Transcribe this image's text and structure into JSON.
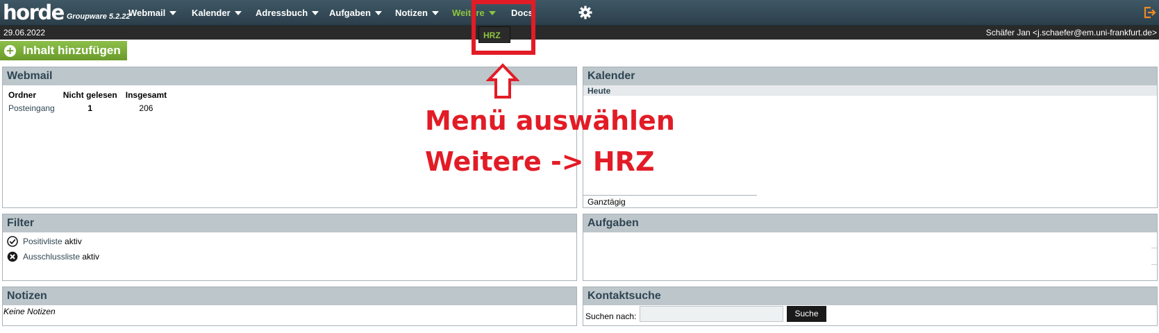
{
  "logo": {
    "word": "horde",
    "subtitle": "Groupware 5.2.22"
  },
  "nav": {
    "items": [
      {
        "label": "Webmail"
      },
      {
        "label": "Kalender"
      },
      {
        "label": "Adressbuch"
      },
      {
        "label": "Aufgaben"
      },
      {
        "label": "Notizen"
      },
      {
        "label": "Weitere"
      },
      {
        "label": "Docs"
      }
    ],
    "active": "Weitere",
    "settings_icon": "gear-icon",
    "logout_icon": "logout-icon"
  },
  "subbar": {
    "date": "29.06.2022",
    "user": "Schäfer Jan <j.schaefer@em.uni-frankfurt.de>"
  },
  "dropdown": {
    "items": [
      "HRZ"
    ]
  },
  "add_content": {
    "label": "Inhalt hinzufügen",
    "icon": "plus-circle-icon"
  },
  "webmail": {
    "title": "Webmail",
    "columns": [
      "Ordner",
      "Nicht gelesen",
      "Insgesamt"
    ],
    "rows": [
      {
        "folder": "Posteingang",
        "unread": "1",
        "total": "206"
      }
    ]
  },
  "kalender": {
    "title": "Kalender",
    "today": "Heute",
    "all_day": "Ganztägig"
  },
  "filter": {
    "title": "Filter",
    "items": [
      {
        "link": "Positivliste",
        "status": "aktiv",
        "icon": "check-circle-icon"
      },
      {
        "link": "Ausschlussliste",
        "status": "aktiv",
        "icon": "x-circle-icon"
      }
    ]
  },
  "aufgaben": {
    "title": "Aufgaben"
  },
  "notizen": {
    "title": "Notizen",
    "empty": "Keine Notizen"
  },
  "kontaktsuche": {
    "title": "Kontaktsuche",
    "label": "Suchen nach:",
    "button": "Suche",
    "value": ""
  },
  "annotation": {
    "line1": "Menü auswählen",
    "line2": "Weitere -> HRZ"
  },
  "colors": {
    "topbar": "#34495a",
    "accent_green": "#8ec63f",
    "annotation_red": "#e21c26",
    "portlet_header": "#bdc6ca"
  }
}
